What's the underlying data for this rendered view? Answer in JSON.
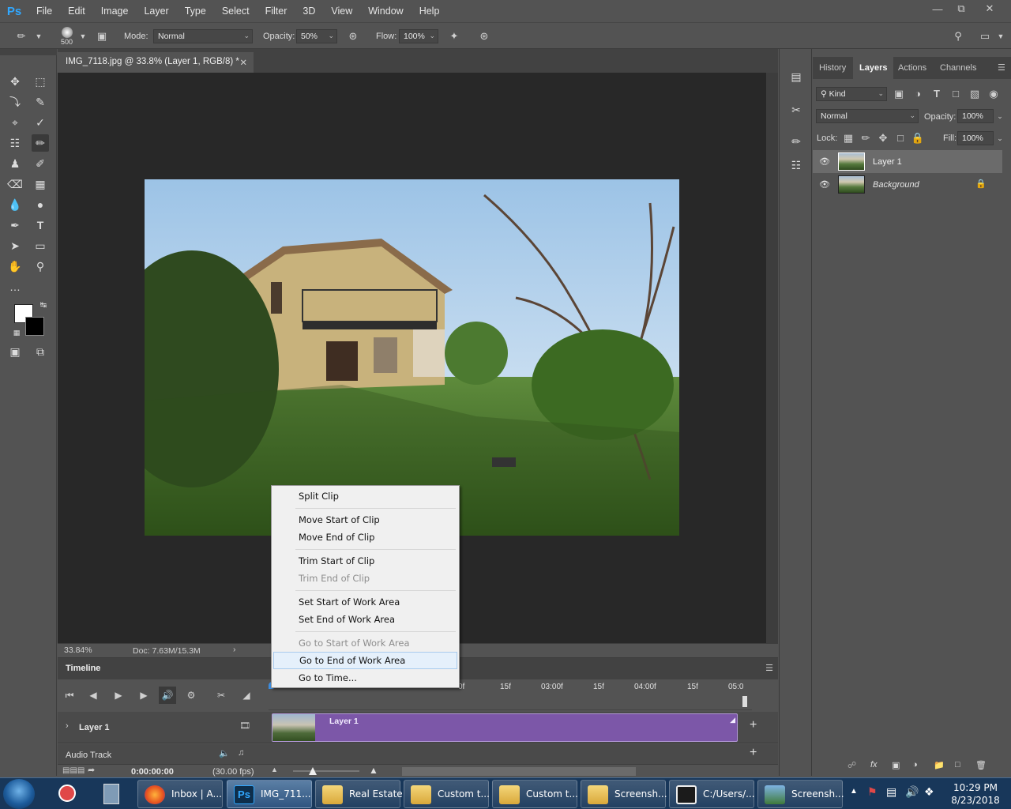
{
  "app": {
    "logo": "Ps",
    "menus": [
      "File",
      "Edit",
      "Image",
      "Layer",
      "Type",
      "Select",
      "Filter",
      "3D",
      "View",
      "Window",
      "Help"
    ]
  },
  "options_bar": {
    "brush_size": "500",
    "mode_label": "Mode:",
    "mode_value": "Normal",
    "opacity_label": "Opacity:",
    "opacity_value": "50%",
    "flow_label": "Flow:",
    "flow_value": "100%"
  },
  "document": {
    "tab_title": "IMG_7118.jpg @ 33.8% (Layer 1, RGB/8) *",
    "zoom": "33.84%",
    "doc_info": "Doc: 7.63M/15.3M"
  },
  "timeline": {
    "title": "Timeline",
    "ruler_labels": [
      "0f",
      "15f",
      "03:00f",
      "15f",
      "04:00f",
      "15f",
      "05:0"
    ],
    "track_name": "Layer 1",
    "clip_label": "Layer 1",
    "audio_track": "Audio Track",
    "timecode": "0:00:00:00",
    "fps": "(30.00 fps)"
  },
  "context_menu": {
    "items": [
      {
        "label": "Split Clip",
        "enabled": true
      },
      {
        "label": "Move Start of Clip",
        "enabled": true
      },
      {
        "label": "Move End of Clip",
        "enabled": true
      },
      {
        "label": "Trim Start of Clip",
        "enabled": true
      },
      {
        "label": "Trim End of Clip",
        "enabled": false
      },
      {
        "label": "Set Start of Work Area",
        "enabled": true
      },
      {
        "label": "Set End of Work Area",
        "enabled": true
      },
      {
        "label": "Go to Start of Work Area",
        "enabled": false
      },
      {
        "label": "Go to End of Work Area",
        "enabled": true,
        "highlighted": true
      },
      {
        "label": "Go to Time...",
        "enabled": true
      }
    ]
  },
  "layers_panel": {
    "tabs": [
      "History",
      "Layers",
      "Actions",
      "Channels"
    ],
    "active_tab": "Layers",
    "filter_kind": "Kind",
    "blend_mode": "Normal",
    "opacity_label": "Opacity:",
    "opacity_value": "100%",
    "lock_label": "Lock:",
    "fill_label": "Fill:",
    "fill_value": "100%",
    "layers": [
      {
        "name": "Layer 1",
        "selected": true,
        "locked": false
      },
      {
        "name": "Background",
        "selected": false,
        "locked": true
      }
    ]
  },
  "taskbar": {
    "apps": [
      {
        "label": "Inbox | A..."
      },
      {
        "label": "IMG_711...",
        "active": true
      },
      {
        "label": "Real Estate"
      },
      {
        "label": "Custom t..."
      },
      {
        "label": "Custom t..."
      },
      {
        "label": "Screensh..."
      },
      {
        "label": "C:/Users/..."
      },
      {
        "label": "Screensh..."
      }
    ],
    "time": "10:29 PM",
    "date": "8/23/2018"
  },
  "colors": {
    "accent_ps": "#31a8ff",
    "clip_purple": "#7c57a8",
    "panel_bg": "#535353",
    "canvas_bg": "#282828"
  }
}
